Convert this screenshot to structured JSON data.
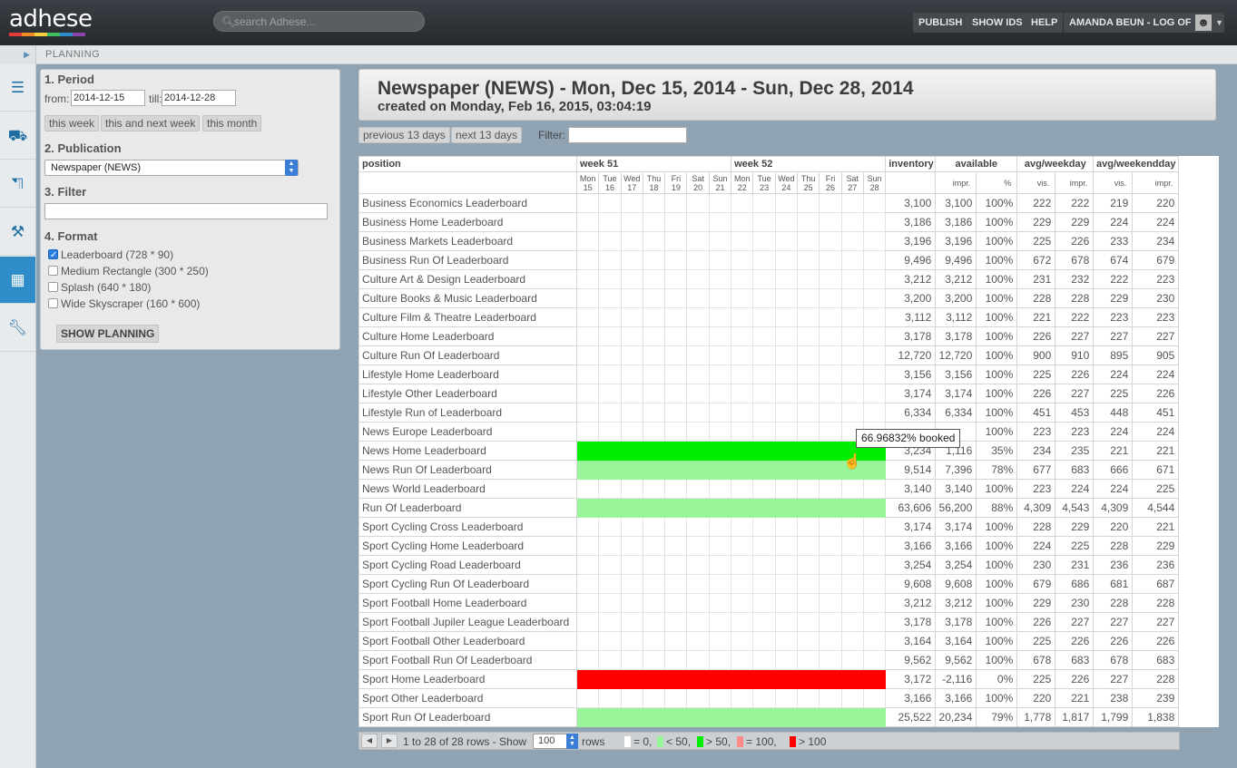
{
  "app": {
    "logo_text": "adhese",
    "search_placeholder": "search Adhese...",
    "nav": {
      "publish": "PUBLISH",
      "show_ids": "SHOW IDS",
      "help": "HELP",
      "user": "AMANDA BEUN - LOG OFF"
    },
    "breadcrumb": "PLANNING",
    "logo_colors": [
      "#e23b3b",
      "#f08a24",
      "#f4d03f",
      "#3fbf5f",
      "#2e8cc9",
      "#8e44ad"
    ]
  },
  "panel": {
    "period_heading": "1. Period",
    "from_label": "from:",
    "from_value": "2014-12-15",
    "till_label": "till:",
    "till_value": "2014-12-28",
    "quick_buttons": [
      "this week",
      "this and next week",
      "this month"
    ],
    "publication_heading": "2. Publication",
    "publication_value": "Newspaper (NEWS)",
    "filter_heading": "3. Filter",
    "filter_value": "",
    "format_heading": "4. Format",
    "formats": [
      {
        "label": "Leaderboard (728 * 90)",
        "checked": true
      },
      {
        "label": "Medium Rectangle (300 * 250)",
        "checked": false
      },
      {
        "label": "Splash (640 * 180)",
        "checked": false
      },
      {
        "label": "Wide Skyscraper (160 * 600)",
        "checked": false
      }
    ],
    "show_planning": "SHOW PLANNING"
  },
  "header": {
    "title": "Newspaper (NEWS) - Mon, Dec 15, 2014 - Sun, Dec 28, 2014",
    "subtitle": "created on Monday, Feb 16, 2015, 03:04:19"
  },
  "controls": {
    "prev": "previous 13 days",
    "next": "next 13 days",
    "filter_label": "Filter:"
  },
  "table": {
    "col_position": "position",
    "weeks": [
      "week 51",
      "week 52"
    ],
    "days": [
      {
        "d": "Mon",
        "n": "15"
      },
      {
        "d": "Tue",
        "n": "16"
      },
      {
        "d": "Wed",
        "n": "17"
      },
      {
        "d": "Thu",
        "n": "18"
      },
      {
        "d": "Fri",
        "n": "19"
      },
      {
        "d": "Sat",
        "n": "20"
      },
      {
        "d": "Sun",
        "n": "21"
      },
      {
        "d": "Mon",
        "n": "22"
      },
      {
        "d": "Tue",
        "n": "23"
      },
      {
        "d": "Wed",
        "n": "24"
      },
      {
        "d": "Thu",
        "n": "25"
      },
      {
        "d": "Fri",
        "n": "26"
      },
      {
        "d": "Sat",
        "n": "27"
      },
      {
        "d": "Sun",
        "n": "28"
      }
    ],
    "col_inventory": "inventory",
    "col_available": "available",
    "col_avg_weekday": "avg/weekday",
    "col_avg_weekendday": "avg/weekendday",
    "sub_impr": "impr.",
    "sub_pct": "%",
    "sub_vis": "vis.",
    "rows": [
      {
        "position": "Business Economics Leaderboard",
        "level": 0,
        "inventory": "3,100",
        "available": "3,100",
        "pct": "100%",
        "wd_vis": "222",
        "wd_impr": "222",
        "we_vis": "219",
        "we_impr": "220"
      },
      {
        "position": "Business Home Leaderboard",
        "level": 0,
        "inventory": "3,186",
        "available": "3,186",
        "pct": "100%",
        "wd_vis": "229",
        "wd_impr": "229",
        "we_vis": "224",
        "we_impr": "224"
      },
      {
        "position": "Business Markets Leaderboard",
        "level": 0,
        "inventory": "3,196",
        "available": "3,196",
        "pct": "100%",
        "wd_vis": "225",
        "wd_impr": "226",
        "we_vis": "233",
        "we_impr": "234"
      },
      {
        "position": "Business Run Of Leaderboard",
        "level": 0,
        "inventory": "9,496",
        "available": "9,496",
        "pct": "100%",
        "wd_vis": "672",
        "wd_impr": "678",
        "we_vis": "674",
        "we_impr": "679"
      },
      {
        "position": "Culture Art & Design Leaderboard",
        "level": 0,
        "inventory": "3,212",
        "available": "3,212",
        "pct": "100%",
        "wd_vis": "231",
        "wd_impr": "232",
        "we_vis": "222",
        "we_impr": "223"
      },
      {
        "position": "Culture Books & Music Leaderboard",
        "level": 0,
        "inventory": "3,200",
        "available": "3,200",
        "pct": "100%",
        "wd_vis": "228",
        "wd_impr": "228",
        "we_vis": "229",
        "we_impr": "230"
      },
      {
        "position": "Culture Film & Theatre Leaderboard",
        "level": 0,
        "inventory": "3,112",
        "available": "3,112",
        "pct": "100%",
        "wd_vis": "221",
        "wd_impr": "222",
        "we_vis": "223",
        "we_impr": "223"
      },
      {
        "position": "Culture Home Leaderboard",
        "level": 0,
        "inventory": "3,178",
        "available": "3,178",
        "pct": "100%",
        "wd_vis": "226",
        "wd_impr": "227",
        "we_vis": "227",
        "we_impr": "227"
      },
      {
        "position": "Culture Run Of Leaderboard",
        "level": 0,
        "inventory": "12,720",
        "available": "12,720",
        "pct": "100%",
        "wd_vis": "900",
        "wd_impr": "910",
        "we_vis": "895",
        "we_impr": "905"
      },
      {
        "position": "Lifestyle Home Leaderboard",
        "level": 0,
        "inventory": "3,156",
        "available": "3,156",
        "pct": "100%",
        "wd_vis": "225",
        "wd_impr": "226",
        "we_vis": "224",
        "we_impr": "224"
      },
      {
        "position": "Lifestyle Other Leaderboard",
        "level": 0,
        "inventory": "3,174",
        "available": "3,174",
        "pct": "100%",
        "wd_vis": "226",
        "wd_impr": "227",
        "we_vis": "225",
        "we_impr": "226"
      },
      {
        "position": "Lifestyle Run of Leaderboard",
        "level": 0,
        "inventory": "6,334",
        "available": "6,334",
        "pct": "100%",
        "wd_vis": "451",
        "wd_impr": "453",
        "we_vis": "448",
        "we_impr": "451"
      },
      {
        "position": "News Europe Leaderboard",
        "level": 0,
        "inventory": "",
        "available": "",
        "pct": "100%",
        "wd_vis": "223",
        "wd_impr": "223",
        "we_vis": "224",
        "we_impr": "224"
      },
      {
        "position": "News Home Leaderboard",
        "level": 2,
        "inventory": "3,234",
        "available": "1,116",
        "pct": "35%",
        "wd_vis": "234",
        "wd_impr": "235",
        "we_vis": "221",
        "we_impr": "221"
      },
      {
        "position": "News Run Of Leaderboard",
        "level": 1,
        "inventory": "9,514",
        "available": "7,396",
        "pct": "78%",
        "wd_vis": "677",
        "wd_impr": "683",
        "we_vis": "666",
        "we_impr": "671"
      },
      {
        "position": "News World Leaderboard",
        "level": 0,
        "inventory": "3,140",
        "available": "3,140",
        "pct": "100%",
        "wd_vis": "223",
        "wd_impr": "224",
        "we_vis": "224",
        "we_impr": "225"
      },
      {
        "position": "Run Of Leaderboard",
        "level": 1,
        "inventory": "63,606",
        "available": "56,200",
        "pct": "88%",
        "wd_vis": "4,309",
        "wd_impr": "4,543",
        "we_vis": "4,309",
        "we_impr": "4,544"
      },
      {
        "position": "Sport Cycling Cross Leaderboard",
        "level": 0,
        "inventory": "3,174",
        "available": "3,174",
        "pct": "100%",
        "wd_vis": "228",
        "wd_impr": "229",
        "we_vis": "220",
        "we_impr": "221"
      },
      {
        "position": "Sport Cycling Home Leaderboard",
        "level": 0,
        "inventory": "3,166",
        "available": "3,166",
        "pct": "100%",
        "wd_vis": "224",
        "wd_impr": "225",
        "we_vis": "228",
        "we_impr": "229"
      },
      {
        "position": "Sport Cycling Road Leaderboard",
        "level": 0,
        "inventory": "3,254",
        "available": "3,254",
        "pct": "100%",
        "wd_vis": "230",
        "wd_impr": "231",
        "we_vis": "236",
        "we_impr": "236"
      },
      {
        "position": "Sport Cycling Run Of Leaderboard",
        "level": 0,
        "inventory": "9,608",
        "available": "9,608",
        "pct": "100%",
        "wd_vis": "679",
        "wd_impr": "686",
        "we_vis": "681",
        "we_impr": "687"
      },
      {
        "position": "Sport Football Home Leaderboard",
        "level": 0,
        "inventory": "3,212",
        "available": "3,212",
        "pct": "100%",
        "wd_vis": "229",
        "wd_impr": "230",
        "we_vis": "228",
        "we_impr": "228"
      },
      {
        "position": "Sport Football Jupiler League Leaderboard",
        "level": 0,
        "inventory": "3,178",
        "available": "3,178",
        "pct": "100%",
        "wd_vis": "226",
        "wd_impr": "227",
        "we_vis": "227",
        "we_impr": "227"
      },
      {
        "position": "Sport Football Other Leaderboard",
        "level": 0,
        "inventory": "3,164",
        "available": "3,164",
        "pct": "100%",
        "wd_vis": "225",
        "wd_impr": "226",
        "we_vis": "226",
        "we_impr": "226"
      },
      {
        "position": "Sport Football Run Of Leaderboard",
        "level": 0,
        "inventory": "9,562",
        "available": "9,562",
        "pct": "100%",
        "wd_vis": "678",
        "wd_impr": "683",
        "we_vis": "678",
        "we_impr": "683"
      },
      {
        "position": "Sport Home Leaderboard",
        "level": 3,
        "inventory": "3,172",
        "available": "-2,116",
        "pct": "0%",
        "wd_vis": "225",
        "wd_impr": "226",
        "we_vis": "227",
        "we_impr": "228"
      },
      {
        "position": "Sport Other Leaderboard",
        "level": 0,
        "inventory": "3,166",
        "available": "3,166",
        "pct": "100%",
        "wd_vis": "220",
        "wd_impr": "221",
        "we_vis": "238",
        "we_impr": "239"
      },
      {
        "position": "Sport Run Of Leaderboard",
        "level": 1,
        "inventory": "25,522",
        "available": "20,234",
        "pct": "79%",
        "wd_vis": "1,778",
        "wd_impr": "1,817",
        "we_vis": "1,799",
        "we_impr": "1,838"
      }
    ]
  },
  "footer": {
    "pager_text": "1 to 28 of 28 rows - Show",
    "rows_value": "100",
    "rows_label": "rows",
    "legend": [
      {
        "label": "= 0,",
        "color": "#ffffff"
      },
      {
        "label": "< 50,",
        "color": "#99f599"
      },
      {
        "label": "> 50,",
        "color": "#00ee00"
      },
      {
        "label": "= 100,",
        "color": "#ff8a8a"
      },
      {
        "label": "> 100",
        "color": "#ff0000"
      }
    ]
  },
  "tooltip": "66.96832% booked"
}
